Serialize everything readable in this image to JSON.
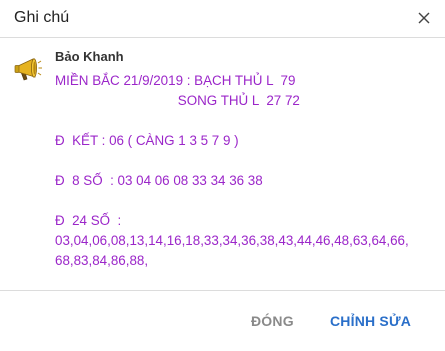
{
  "dialog": {
    "title": "Ghi chú"
  },
  "note": {
    "author": "Bảo Khanh",
    "avatar_icon": "megaphone-icon",
    "text": "MIỀN BẮC 21/9/2019 : BẠCH THỦ L  79\n                                 SONG THỦ L  27 72\n\nĐ  KẾT : 06 ( CÀNG 1 3 5 7 9 )\n\nĐ  8 SỐ  : 03 04 06 08 33 34 36 38\n\nĐ  24 SỐ  :\n03,04,06,08,13,14,16,18,33,34,36,38,43,44,46,48,63,64,66,\n68,83,84,86,88,"
  },
  "footer": {
    "close_label": "ĐÓNG",
    "edit_label": "CHỈNH SỬA"
  },
  "colors": {
    "note_text": "#9b26c9",
    "primary_button": "#2a6fc9",
    "secondary_button": "#8a8a8a"
  }
}
